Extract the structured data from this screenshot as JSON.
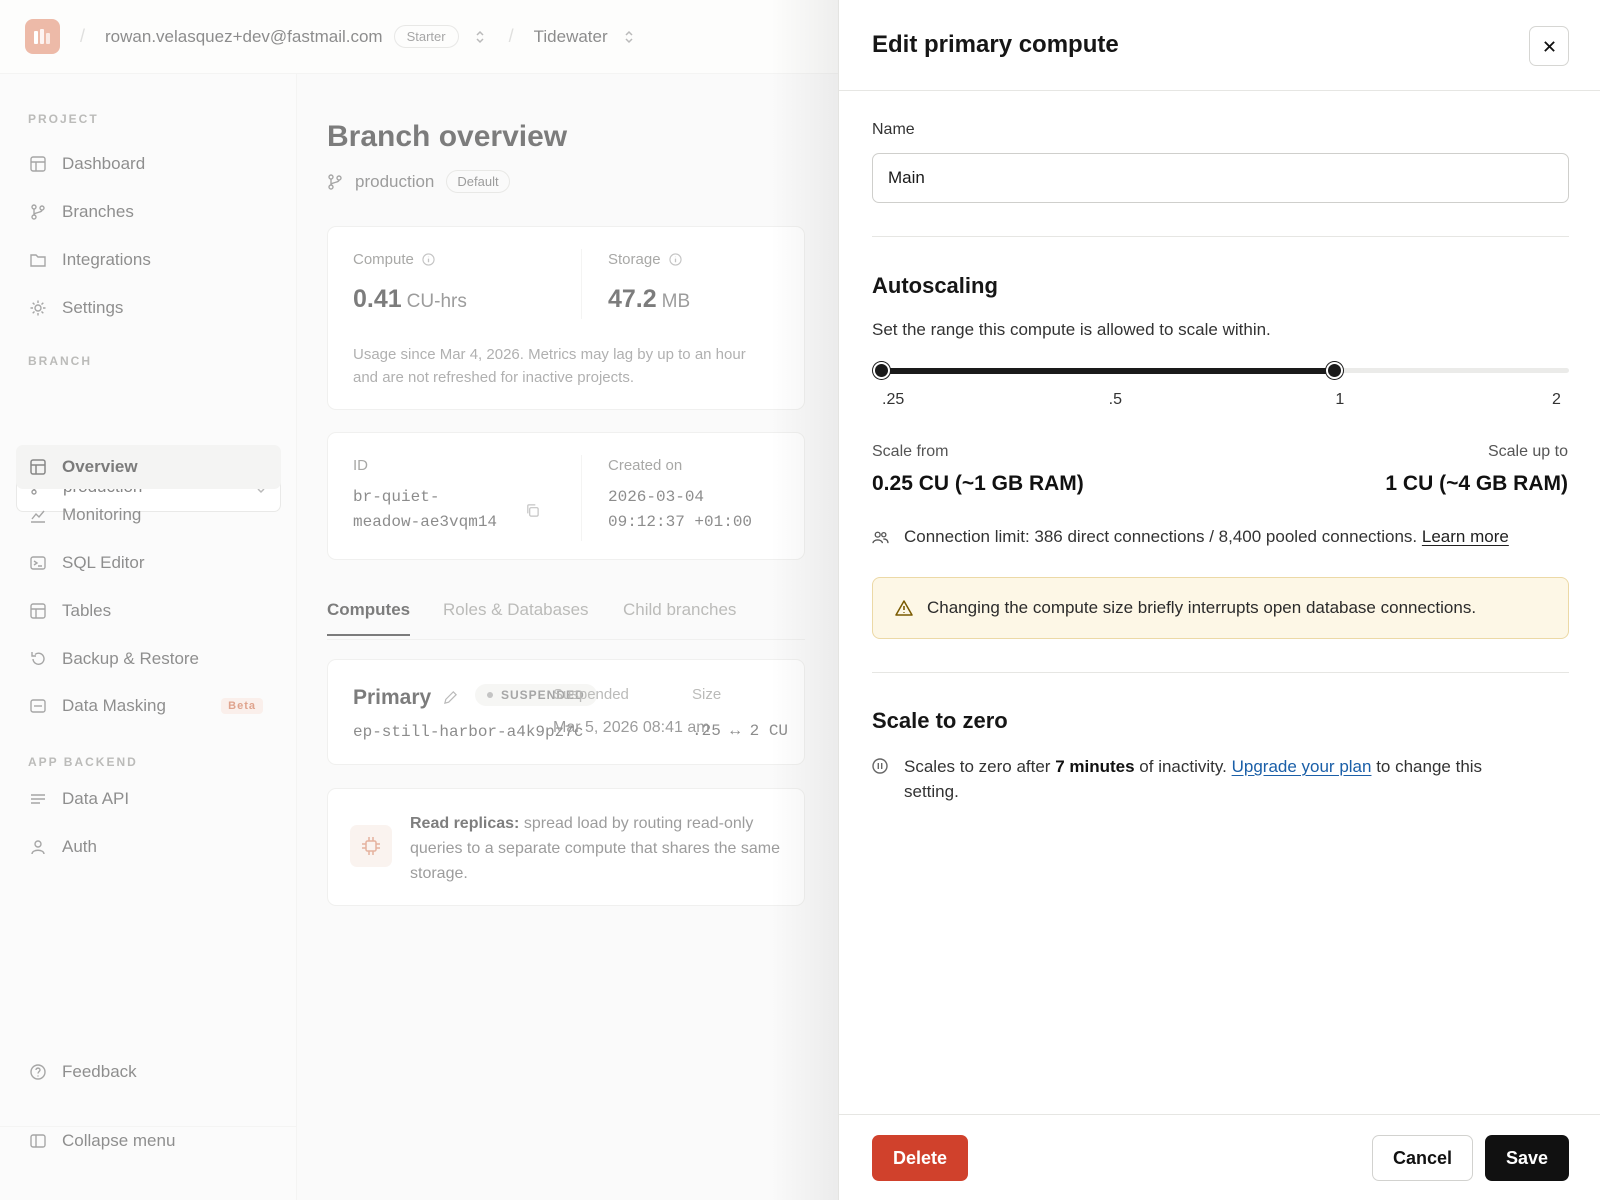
{
  "topbar": {
    "email": "rowan.velasquez+dev@fastmail.com",
    "plan": "Starter",
    "project": "Tidewater"
  },
  "sidebar": {
    "project_label": "PROJECT",
    "project_items": [
      "Dashboard",
      "Branches",
      "Integrations",
      "Settings"
    ],
    "branch_label": "BRANCH",
    "branch_selected": "production",
    "branch_items": [
      "Overview",
      "Monitoring",
      "SQL Editor",
      "Tables",
      "Backup & Restore",
      "Data Masking"
    ],
    "beta": "Beta",
    "app_backend_label": "APP BACKEND",
    "app_backend_items": [
      "Data API",
      "Auth"
    ],
    "feedback": "Feedback",
    "collapse": "Collapse menu"
  },
  "main": {
    "title": "Branch overview",
    "branch": "production",
    "branch_badge": "Default",
    "compute_label": "Compute",
    "compute_value": "0.41",
    "compute_unit": "CU-hrs",
    "storage_label": "Storage",
    "storage_value": "47.2",
    "storage_unit": "MB",
    "usage_note": "Usage since Mar 4, 2026. Metrics may lag by up to an hour and are not refreshed for inactive projects.",
    "id_label": "ID",
    "id_line1": "br-quiet-",
    "id_line2": "meadow-ae3vqm14",
    "created_label": "Created on",
    "created_line1": "2026-03-04",
    "created_line2": "09:12:37 +01:00",
    "tabs": [
      "Computes",
      "Roles & Databases",
      "Child branches"
    ],
    "primary_name": "Primary",
    "primary_status": "SUSPENDED",
    "primary_endpoint": "ep-still-harbor-a4k9pz7c",
    "suspended_label": "Suspended",
    "suspended_value": "Mar 5, 2026 08:41 am",
    "size_label": "Size",
    "size_value": ".25 ↔ 2 CU",
    "replicas_bold": "Read replicas:",
    "replicas_text": "spread load by routing read-only queries to a separate compute that shares the same storage."
  },
  "drawer": {
    "title": "Edit primary compute",
    "name_label": "Name",
    "name_value": "Main",
    "autoscaling_title": "Autoscaling",
    "autoscaling_desc": "Set the range this compute is allowed to scale within.",
    "slider": {
      "ticks": [
        ".25",
        ".5",
        "1",
        "2"
      ],
      "min_index": 0,
      "max_index": 2
    },
    "scale_from_label": "Scale from",
    "scale_from_value": "0.25 CU (~1 GB RAM)",
    "scale_to_label": "Scale up to",
    "scale_to_value": "1 CU (~4 GB RAM)",
    "connection_text": "Connection limit: 386 direct connections / 8,400 pooled connections.",
    "learn_more": "Learn more",
    "warning": "Changing the compute size briefly interrupts open database connections.",
    "scale_zero_title": "Scale to zero",
    "stz_pre": "Scales to zero after",
    "stz_bold": "7 minutes",
    "stz_mid": "of inactivity.",
    "stz_link": "Upgrade your plan",
    "stz_post": "to change this setting.",
    "delete": "Delete",
    "cancel": "Cancel",
    "save": "Save"
  }
}
